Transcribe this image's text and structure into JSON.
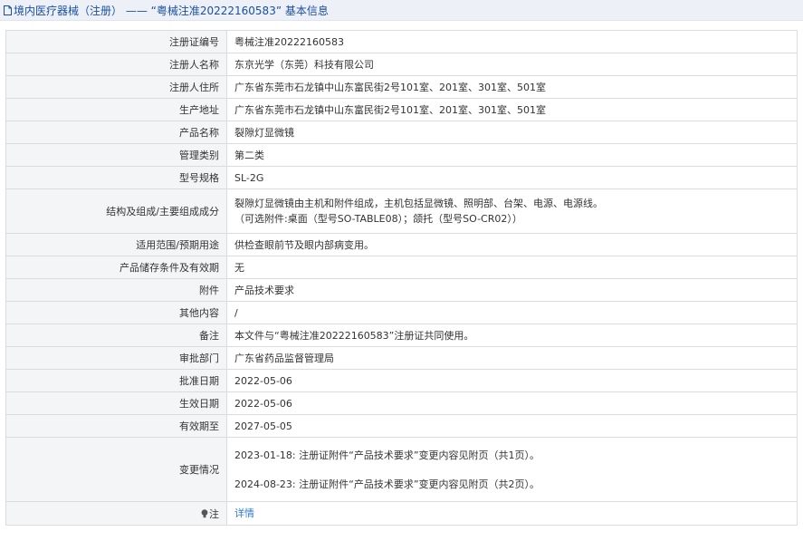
{
  "header": {
    "title": "境内医疗器械（注册） —— “粤械注准20222160583” 基本信息"
  },
  "rows": [
    {
      "label": "注册证编号",
      "value": "粤械注准20222160583"
    },
    {
      "label": "注册人名称",
      "value": "东京光学（东莞）科技有限公司"
    },
    {
      "label": "注册人住所",
      "value": "广东省东莞市石龙镇中山东富民街2号101室、201室、301室、501室"
    },
    {
      "label": "生产地址",
      "value": "广东省东莞市石龙镇中山东富民街2号101室、201室、301室、501室"
    },
    {
      "label": "产品名称",
      "value": "裂隙灯显微镜"
    },
    {
      "label": "管理类别",
      "value": "第二类"
    },
    {
      "label": "型号规格",
      "value": "SL-2G"
    },
    {
      "label": "结构及组成/主要组成成分",
      "value_line1": "裂隙灯显微镜由主机和附件组成，主机包括显微镜、照明部、台架、电源、电源线。",
      "value_line2": "（可选附件:桌面（型号SO-TABLE08）；颌托（型号SO-CR02））"
    },
    {
      "label": "适用范围/预期用途",
      "value": "供检查眼前节及眼内部病变用。"
    },
    {
      "label": "产品储存条件及有效期",
      "value": "无"
    },
    {
      "label": "附件",
      "value": "产品技术要求"
    },
    {
      "label": "其他内容",
      "value": "/"
    },
    {
      "label": "备注",
      "value": "本文件与“粤械注准20222160583”注册证共同使用。"
    },
    {
      "label": "审批部门",
      "value": "广东省药品监督管理局"
    },
    {
      "label": "批准日期",
      "value": "2022-05-06"
    },
    {
      "label": "生效日期",
      "value": "2022-05-06"
    },
    {
      "label": "有效期至",
      "value": "2027-05-05"
    },
    {
      "label": "变更情况",
      "changes": [
        "2023-01-18: 注册证附件“产品技术要求”变更内容见附页（共1页）。",
        "2024-08-23: 注册证附件“产品技术要求”变更内容见附页（共2页）。"
      ]
    },
    {
      "label": "注",
      "value": "详情"
    }
  ],
  "colors": {
    "header_bg": "#edf1f7",
    "title_text": "#1a4fa0",
    "label_bg": "#f4f5f7",
    "link": "#2f7bd1",
    "border": "#dcdcdc"
  },
  "icons": {
    "title": "document-icon",
    "note": "lightbulb-icon"
  }
}
